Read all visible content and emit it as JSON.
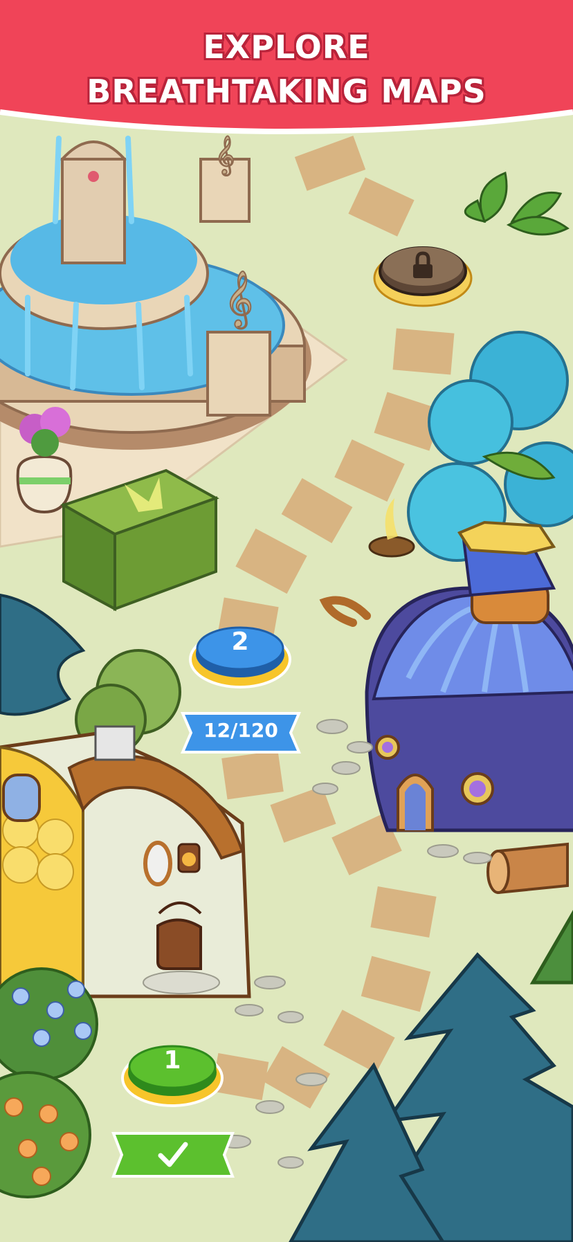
{
  "banner": {
    "line1": "EXPLORE",
    "line2": "BREATHTAKING MAPS",
    "color": "#f04458"
  },
  "map": {
    "background": "#dfe8bd",
    "path_tile_color": "#d8b482",
    "levels": [
      {
        "number": "1",
        "state": "completed",
        "color": "#5cc02e"
      },
      {
        "number": "2",
        "state": "current",
        "color": "#3a8fe0",
        "progress": "12/120"
      },
      {
        "state": "locked",
        "icon": "lock-icon"
      }
    ]
  },
  "icons": {
    "completed": "checkmark-icon",
    "locked": "lock-icon"
  }
}
